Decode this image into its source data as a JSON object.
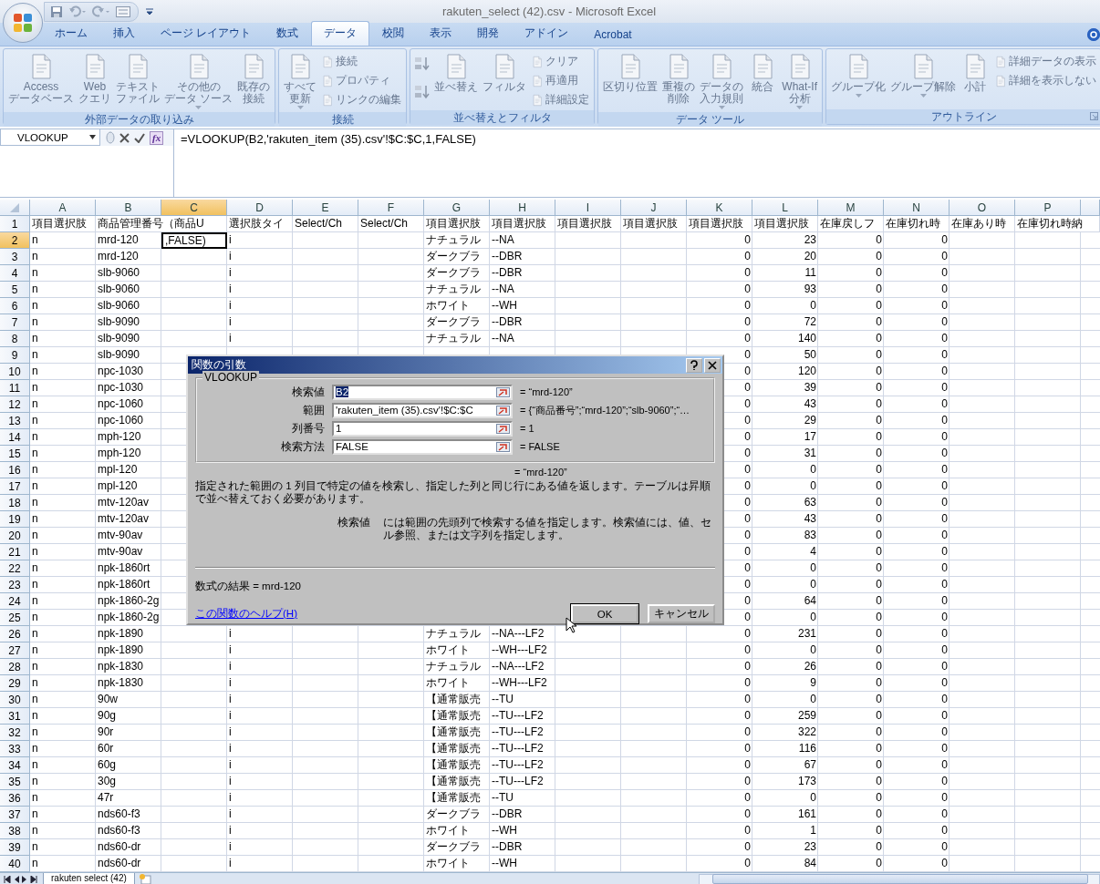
{
  "window": {
    "title": "rakuten_select (42).csv - Microsoft Excel"
  },
  "tabs": [
    {
      "label": "ホーム",
      "selected": false
    },
    {
      "label": "挿入",
      "selected": false
    },
    {
      "label": "ページ レイアウト",
      "selected": false
    },
    {
      "label": "数式",
      "selected": false
    },
    {
      "label": "データ",
      "selected": true
    },
    {
      "label": "校閲",
      "selected": false
    },
    {
      "label": "表示",
      "selected": false
    },
    {
      "label": "開発",
      "selected": false
    },
    {
      "label": "アドイン",
      "selected": false
    },
    {
      "label": "Acrobat",
      "selected": false
    }
  ],
  "ribbon": {
    "disabled": true,
    "groups": [
      {
        "label": "外部データの取り込み",
        "buttons": [
          {
            "kind": "large",
            "lines": [
              "Access",
              "データベース"
            ]
          },
          {
            "kind": "large",
            "lines": [
              "Web",
              "クエリ"
            ]
          },
          {
            "kind": "large",
            "lines": [
              "テキスト",
              "ファイル"
            ]
          },
          {
            "kind": "large",
            "lines": [
              "その他の",
              "データ ソース"
            ],
            "dropdown": true
          },
          {
            "kind": "large",
            "lines": [
              "既存の",
              "接続"
            ]
          }
        ]
      },
      {
        "buttons": [
          {
            "kind": "large",
            "lines": [
              "すべて",
              "更新"
            ],
            "dropdown": true
          },
          {
            "kind": "small",
            "label": "接続"
          },
          {
            "kind": "small",
            "label": "プロパティ"
          },
          {
            "kind": "small",
            "label": "リンクの編集"
          }
        ],
        "label": "接続"
      },
      {
        "label": "並べ替えとフィルタ",
        "buttons": [
          {
            "kind": "sort"
          },
          {
            "kind": "sort"
          },
          {
            "kind": "large",
            "lines": [
              "並べ替え"
            ]
          },
          {
            "kind": "large",
            "lines": [
              "フィルタ"
            ]
          },
          {
            "kind": "small",
            "label": "クリア"
          },
          {
            "kind": "small",
            "label": "再適用"
          },
          {
            "kind": "small",
            "label": "詳細設定"
          }
        ]
      },
      {
        "label": "データ ツール",
        "buttons": [
          {
            "kind": "large",
            "lines": [
              "区切り位置"
            ]
          },
          {
            "kind": "large",
            "lines": [
              "重複の",
              "削除"
            ]
          },
          {
            "kind": "large",
            "lines": [
              "データの",
              "入力規則"
            ],
            "dropdown": true
          },
          {
            "kind": "large",
            "lines": [
              "統合"
            ]
          },
          {
            "kind": "large",
            "lines": [
              "What-If",
              "分析"
            ],
            "dropdown": true
          }
        ]
      },
      {
        "label": "アウトライン",
        "launcher": true,
        "buttons": [
          {
            "kind": "large",
            "lines": [
              "グループ化"
            ],
            "dropdown": true
          },
          {
            "kind": "large",
            "lines": [
              "グループ解除"
            ],
            "dropdown": true
          },
          {
            "kind": "large",
            "lines": [
              "小計"
            ]
          },
          {
            "kind": "small",
            "label": "詳細データの表示"
          },
          {
            "kind": "small",
            "label": "詳細を表示しない"
          }
        ]
      }
    ]
  },
  "formula_bar": {
    "name_box": "VLOOKUP",
    "function_button": "fx",
    "formula": "=VLOOKUP(B2,'rakuten_item (35).csv'!$C:$C,1,FALSE)"
  },
  "grid": {
    "columns": [
      {
        "label": "A",
        "selected": false
      },
      {
        "label": "B",
        "selected": false
      },
      {
        "label": "C",
        "selected": true
      },
      {
        "label": "D",
        "selected": false
      },
      {
        "label": "E",
        "selected": false
      },
      {
        "label": "F",
        "selected": false
      },
      {
        "label": "G",
        "selected": false
      },
      {
        "label": "H",
        "selected": false
      },
      {
        "label": "I",
        "selected": false
      },
      {
        "label": "J",
        "selected": false
      },
      {
        "label": "K",
        "selected": false,
        "numeric": true
      },
      {
        "label": "L",
        "selected": false,
        "numeric": true
      },
      {
        "label": "M",
        "selected": false,
        "numeric": true
      },
      {
        "label": "N",
        "selected": false,
        "numeric": true
      },
      {
        "label": "O",
        "selected": false
      },
      {
        "label": "P",
        "selected": false
      }
    ],
    "header_row": {
      "label": "1",
      "selected": false,
      "cells": {
        "A": "項目選択肢",
        "B": "商品管理番号（商品U",
        "D": "選択肢タイ",
        "E": "Select/Ch",
        "F": "Select/Ch",
        "G": "項目選択肢",
        "H": "項目選択肢",
        "I": "項目選択肢",
        "J": "項目選択肢",
        "K": "項目選択肢",
        "L": "項目選択肢",
        "M": "在庫戻しフ",
        "N": "在庫切れ時",
        "O": "在庫あり時",
        "P": "在庫切れ時納"
      }
    },
    "rows": [
      {
        "label": "2",
        "selected": true,
        "cells": {
          "A": "n",
          "B": "mrd-120",
          "C": ",FALSE)",
          "D": "i",
          "G": "ナチュラル",
          "H": "--NA",
          "K": "0",
          "L": "23",
          "M": "0",
          "N": "0"
        }
      },
      {
        "label": "3",
        "selected": false,
        "cells": {
          "A": "n",
          "B": "mrd-120",
          "D": "i",
          "G": "ダークブラ",
          "H": "--DBR",
          "K": "0",
          "L": "20",
          "M": "0",
          "N": "0"
        }
      },
      {
        "label": "4",
        "selected": false,
        "cells": {
          "A": "n",
          "B": "slb-9060",
          "D": "i",
          "G": "ダークブラ",
          "H": "--DBR",
          "K": "0",
          "L": "11",
          "M": "0",
          "N": "0"
        }
      },
      {
        "label": "5",
        "selected": false,
        "cells": {
          "A": "n",
          "B": "slb-9060",
          "D": "i",
          "G": "ナチュラル",
          "H": "--NA",
          "K": "0",
          "L": "93",
          "M": "0",
          "N": "0"
        }
      },
      {
        "label": "6",
        "selected": false,
        "cells": {
          "A": "n",
          "B": "slb-9060",
          "D": "i",
          "G": "ホワイト",
          "H": "--WH",
          "K": "0",
          "L": "0",
          "M": "0",
          "N": "0"
        }
      },
      {
        "label": "7",
        "selected": false,
        "cells": {
          "A": "n",
          "B": "slb-9090",
          "D": "i",
          "G": "ダークブラ",
          "H": "--DBR",
          "K": "0",
          "L": "72",
          "M": "0",
          "N": "0"
        }
      },
      {
        "label": "8",
        "selected": false,
        "cells": {
          "A": "n",
          "B": "slb-9090",
          "D": "i",
          "G": "ナチュラル",
          "H": "--NA",
          "K": "0",
          "L": "140",
          "M": "0",
          "N": "0"
        }
      },
      {
        "label": "9",
        "selected": false,
        "cells": {
          "A": "n",
          "B": "slb-9090",
          "K": "0",
          "L": "50",
          "M": "0",
          "N": "0"
        }
      },
      {
        "label": "10",
        "selected": false,
        "cells": {
          "A": "n",
          "B": "npc-1030",
          "K": "0",
          "L": "120",
          "M": "0",
          "N": "0"
        }
      },
      {
        "label": "11",
        "selected": false,
        "cells": {
          "A": "n",
          "B": "npc-1030",
          "K": "0",
          "L": "39",
          "M": "0",
          "N": "0"
        }
      },
      {
        "label": "12",
        "selected": false,
        "cells": {
          "A": "n",
          "B": "npc-1060",
          "K": "0",
          "L": "43",
          "M": "0",
          "N": "0"
        }
      },
      {
        "label": "13",
        "selected": false,
        "cells": {
          "A": "n",
          "B": "npc-1060",
          "K": "0",
          "L": "29",
          "M": "0",
          "N": "0"
        }
      },
      {
        "label": "14",
        "selected": false,
        "cells": {
          "A": "n",
          "B": "mph-120",
          "K": "0",
          "L": "17",
          "M": "0",
          "N": "0"
        }
      },
      {
        "label": "15",
        "selected": false,
        "cells": {
          "A": "n",
          "B": "mph-120",
          "K": "0",
          "L": "31",
          "M": "0",
          "N": "0"
        }
      },
      {
        "label": "16",
        "selected": false,
        "cells": {
          "A": "n",
          "B": "mpl-120",
          "K": "0",
          "L": "0",
          "M": "0",
          "N": "0"
        }
      },
      {
        "label": "17",
        "selected": false,
        "cells": {
          "A": "n",
          "B": "mpl-120",
          "K": "0",
          "L": "0",
          "M": "0",
          "N": "0"
        }
      },
      {
        "label": "18",
        "selected": false,
        "cells": {
          "A": "n",
          "B": "mtv-120av",
          "K": "0",
          "L": "63",
          "M": "0",
          "N": "0"
        }
      },
      {
        "label": "19",
        "selected": false,
        "cells": {
          "A": "n",
          "B": "mtv-120av",
          "K": "0",
          "L": "43",
          "M": "0",
          "N": "0"
        }
      },
      {
        "label": "20",
        "selected": false,
        "cells": {
          "A": "n",
          "B": "mtv-90av",
          "K": "0",
          "L": "83",
          "M": "0",
          "N": "0"
        }
      },
      {
        "label": "21",
        "selected": false,
        "cells": {
          "A": "n",
          "B": "mtv-90av",
          "K": "0",
          "L": "4",
          "M": "0",
          "N": "0"
        }
      },
      {
        "label": "22",
        "selected": false,
        "cells": {
          "A": "n",
          "B": "npk-1860rt",
          "K": "0",
          "L": "0",
          "M": "0",
          "N": "0"
        }
      },
      {
        "label": "23",
        "selected": false,
        "cells": {
          "A": "n",
          "B": "npk-1860rt",
          "K": "0",
          "L": "0",
          "M": "0",
          "N": "0"
        }
      },
      {
        "label": "24",
        "selected": false,
        "cells": {
          "A": "n",
          "B": "npk-1860-2g",
          "K": "0",
          "L": "64",
          "M": "0",
          "N": "0"
        }
      },
      {
        "label": "25",
        "selected": false,
        "cells": {
          "A": "n",
          "B": "npk-1860-2g",
          "K": "0",
          "L": "0",
          "M": "0",
          "N": "0"
        }
      },
      {
        "label": "26",
        "selected": false,
        "cells": {
          "A": "n",
          "B": "npk-1890",
          "D": "i",
          "G": "ナチュラル",
          "H": "--NA---LF2",
          "K": "0",
          "L": "231",
          "M": "0",
          "N": "0"
        }
      },
      {
        "label": "27",
        "selected": false,
        "cells": {
          "A": "n",
          "B": "npk-1890",
          "D": "i",
          "G": "ホワイト",
          "H": "--WH---LF2",
          "K": "0",
          "L": "0",
          "M": "0",
          "N": "0"
        }
      },
      {
        "label": "28",
        "selected": false,
        "cells": {
          "A": "n",
          "B": "npk-1830",
          "D": "i",
          "G": "ナチュラル",
          "H": "--NA---LF2",
          "K": "0",
          "L": "26",
          "M": "0",
          "N": "0"
        }
      },
      {
        "label": "29",
        "selected": false,
        "cells": {
          "A": "n",
          "B": "npk-1830",
          "D": "i",
          "G": "ホワイト",
          "H": "--WH---LF2",
          "K": "0",
          "L": "9",
          "M": "0",
          "N": "0"
        }
      },
      {
        "label": "30",
        "selected": false,
        "cells": {
          "A": "n",
          "B": "90w",
          "D": "i",
          "G": "【通常販売",
          "H": "--TU",
          "K": "0",
          "L": "0",
          "M": "0",
          "N": "0"
        }
      },
      {
        "label": "31",
        "selected": false,
        "cells": {
          "A": "n",
          "B": "90g",
          "D": "i",
          "G": "【通常販売",
          "H": "--TU---LF2",
          "K": "0",
          "L": "259",
          "M": "0",
          "N": "0"
        }
      },
      {
        "label": "32",
        "selected": false,
        "cells": {
          "A": "n",
          "B": "90r",
          "D": "i",
          "G": "【通常販売",
          "H": "--TU---LF2",
          "K": "0",
          "L": "322",
          "M": "0",
          "N": "0"
        }
      },
      {
        "label": "33",
        "selected": false,
        "cells": {
          "A": "n",
          "B": "60r",
          "D": "i",
          "G": "【通常販売",
          "H": "--TU---LF2",
          "K": "0",
          "L": "116",
          "M": "0",
          "N": "0"
        }
      },
      {
        "label": "34",
        "selected": false,
        "cells": {
          "A": "n",
          "B": "60g",
          "D": "i",
          "G": "【通常販売",
          "H": "--TU---LF2",
          "K": "0",
          "L": "67",
          "M": "0",
          "N": "0"
        }
      },
      {
        "label": "35",
        "selected": false,
        "cells": {
          "A": "n",
          "B": "30g",
          "D": "i",
          "G": "【通常販売",
          "H": "--TU---LF2",
          "K": "0",
          "L": "173",
          "M": "0",
          "N": "0"
        }
      },
      {
        "label": "36",
        "selected": false,
        "cells": {
          "A": "n",
          "B": "47r",
          "D": "i",
          "G": "【通常販売",
          "H": "--TU",
          "K": "0",
          "L": "0",
          "M": "0",
          "N": "0"
        }
      },
      {
        "label": "37",
        "selected": false,
        "cells": {
          "A": "n",
          "B": "nds60-f3",
          "D": "i",
          "G": "ダークブラ",
          "H": "--DBR",
          "K": "0",
          "L": "161",
          "M": "0",
          "N": "0"
        }
      },
      {
        "label": "38",
        "selected": false,
        "cells": {
          "A": "n",
          "B": "nds60-f3",
          "D": "i",
          "G": "ホワイト",
          "H": "--WH",
          "K": "0",
          "L": "1",
          "M": "0",
          "N": "0"
        }
      },
      {
        "label": "39",
        "selected": false,
        "cells": {
          "A": "n",
          "B": "nds60-dr",
          "D": "i",
          "G": "ダークブラ",
          "H": "--DBR",
          "K": "0",
          "L": "23",
          "M": "0",
          "N": "0"
        }
      },
      {
        "label": "40",
        "selected": false,
        "cells": {
          "A": "n",
          "B": "nds60-dr",
          "D": "i",
          "G": "ホワイト",
          "H": "--WH",
          "K": "0",
          "L": "84",
          "M": "0",
          "N": "0"
        }
      }
    ]
  },
  "dialog": {
    "title": "関数の引数",
    "function": "VLOOKUP",
    "arguments": [
      {
        "label": "検索値",
        "value": "B2",
        "result": "= “mrd-120”",
        "highlighted": true
      },
      {
        "label": "範囲",
        "value": "'rakuten_item (35).csv'!$C:$C",
        "result": "= {“商品番号”;“mrd-120”;“slb-9060”;“…",
        "highlighted": false
      },
      {
        "label": "列番号",
        "value": "1",
        "result": "= 1",
        "highlighted": false
      },
      {
        "label": "検索方法",
        "value": "FALSE",
        "result": "= FALSE",
        "highlighted": false
      }
    ],
    "total_result": "= “mrd-120”",
    "description": "指定された範囲の 1 列目で特定の値を検索し、指定した列と同じ行にある値を返します。テーブルは昇順で並べ替えておく必要があります。",
    "argument_name": "検索値",
    "argument_help": "には範囲の先頭列で検索する値を指定します。検索値には、値、セル参照、または文字列を指定します。",
    "formula_result": "数式の結果 =  mrd-120",
    "help_link": "この関数のヘルプ(H)",
    "buttons": [
      "OK",
      "キャンセル"
    ]
  },
  "sheet_tabs": [
    {
      "label": "rakuten select (42)",
      "selected": true
    }
  ]
}
